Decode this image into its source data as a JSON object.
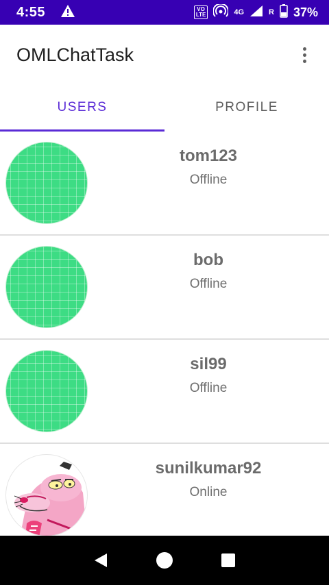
{
  "status_bar": {
    "time": "4:55",
    "volte_top": "VO",
    "volte_bottom": "LTE",
    "network": "4G",
    "roaming": "R",
    "battery": "37%"
  },
  "app_bar": {
    "title": "OMLChatTask"
  },
  "tabs": [
    {
      "label": "USERS",
      "active": true
    },
    {
      "label": "PROFILE",
      "active": false
    }
  ],
  "users": [
    {
      "name": "tom123",
      "status": "Offline",
      "avatar": "default-avatar"
    },
    {
      "name": "bob",
      "status": "Offline",
      "avatar": "default-avatar"
    },
    {
      "name": "sil99",
      "status": "Offline",
      "avatar": "default-avatar"
    },
    {
      "name": "sunilkumar92",
      "status": "Online",
      "avatar": "pink-panther-avatar"
    }
  ],
  "colors": {
    "status_bar": "#3700b3",
    "accent": "#5a2bd6",
    "default_avatar": "#3ddc84",
    "nav_bar": "#000000"
  }
}
